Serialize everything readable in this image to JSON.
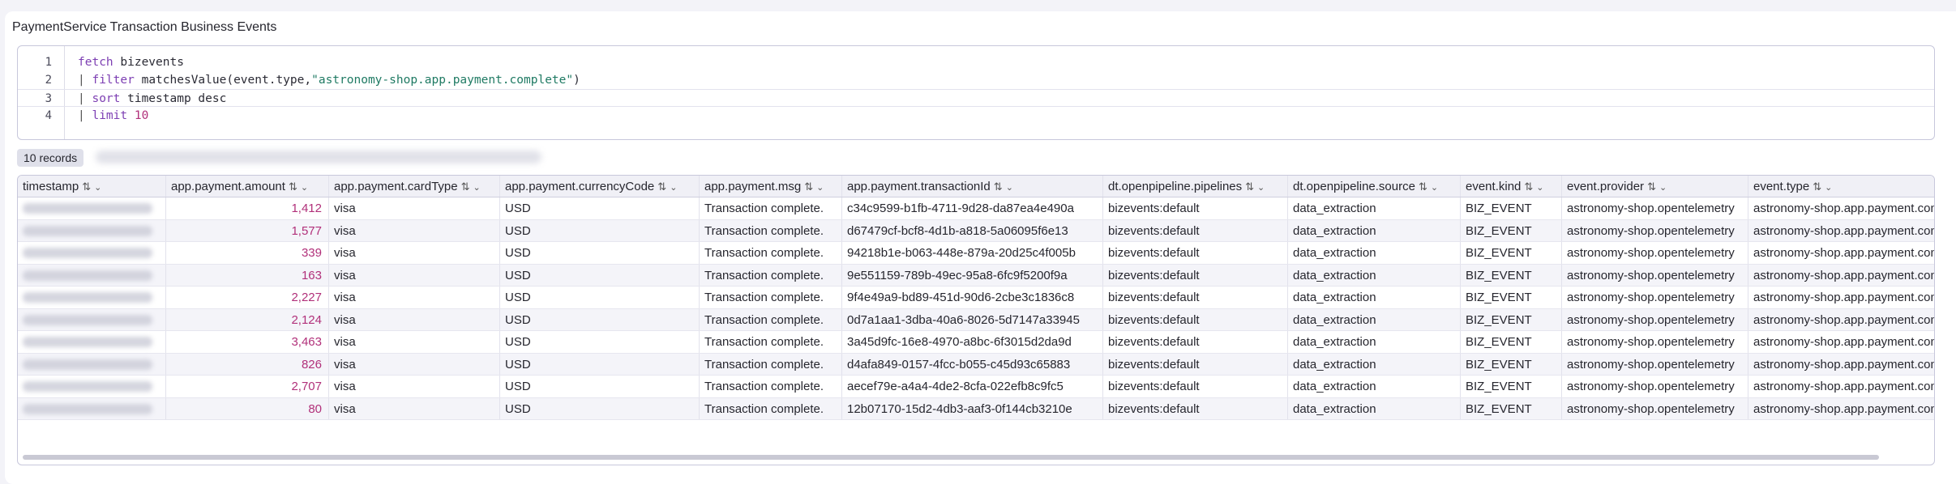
{
  "card": {
    "title": "PaymentService Transaction Business Events"
  },
  "editor": {
    "lines": [
      {
        "num": "1",
        "tokens": [
          {
            "t": "fetch",
            "c": "kw"
          },
          {
            "t": " bizevents",
            "c": ""
          }
        ]
      },
      {
        "num": "2",
        "tokens": [
          {
            "t": "| ",
            "c": "pipe"
          },
          {
            "t": "filter",
            "c": "kw"
          },
          {
            "t": " matchesValue(event.type,",
            "c": ""
          },
          {
            "t": "\"astronomy-shop.app.payment.complete\"",
            "c": "str"
          },
          {
            "t": ")",
            "c": ""
          }
        ]
      },
      {
        "num": "3",
        "tokens": [
          {
            "t": "| ",
            "c": "pipe"
          },
          {
            "t": "sort",
            "c": "kw"
          },
          {
            "t": " timestamp desc",
            "c": ""
          }
        ]
      },
      {
        "num": "4",
        "tokens": [
          {
            "t": "| ",
            "c": "pipe"
          },
          {
            "t": "limit",
            "c": "kw"
          },
          {
            "t": " ",
            "c": ""
          },
          {
            "t": "10",
            "c": "num"
          }
        ]
      }
    ]
  },
  "results": {
    "records_label": "10 records"
  },
  "table": {
    "columns": [
      {
        "key": "timestamp",
        "label": "timestamp"
      },
      {
        "key": "amount",
        "label": "app.payment.amount"
      },
      {
        "key": "cardType",
        "label": "app.payment.cardType"
      },
      {
        "key": "currency",
        "label": "app.payment.currencyCode"
      },
      {
        "key": "msg",
        "label": "app.payment.msg"
      },
      {
        "key": "txid",
        "label": "app.payment.transactionId"
      },
      {
        "key": "pipelines",
        "label": "dt.openpipeline.pipelines"
      },
      {
        "key": "source",
        "label": "dt.openpipeline.source"
      },
      {
        "key": "kind",
        "label": "event.kind"
      },
      {
        "key": "provider",
        "label": "event.provider"
      },
      {
        "key": "type",
        "label": "event.type"
      }
    ],
    "rows": [
      {
        "amount": "1,412",
        "cardType": "visa",
        "currency": "USD",
        "msg": "Transaction complete.",
        "txid": "c34c9599-b1fb-4711-9d28-da87ea4e490a",
        "pipelines": "bizevents:default",
        "source": "data_extraction",
        "kind": "BIZ_EVENT",
        "provider": "astronomy-shop.opentelemetry",
        "type": "astronomy-shop.app.payment.complete"
      },
      {
        "amount": "1,577",
        "cardType": "visa",
        "currency": "USD",
        "msg": "Transaction complete.",
        "txid": "d67479cf-bcf8-4d1b-a818-5a06095f6e13",
        "pipelines": "bizevents:default",
        "source": "data_extraction",
        "kind": "BIZ_EVENT",
        "provider": "astronomy-shop.opentelemetry",
        "type": "astronomy-shop.app.payment.complete"
      },
      {
        "amount": "339",
        "cardType": "visa",
        "currency": "USD",
        "msg": "Transaction complete.",
        "txid": "94218b1e-b063-448e-879a-20d25c4f005b",
        "pipelines": "bizevents:default",
        "source": "data_extraction",
        "kind": "BIZ_EVENT",
        "provider": "astronomy-shop.opentelemetry",
        "type": "astronomy-shop.app.payment.complete"
      },
      {
        "amount": "163",
        "cardType": "visa",
        "currency": "USD",
        "msg": "Transaction complete.",
        "txid": "9e551159-789b-49ec-95a8-6fc9f5200f9a",
        "pipelines": "bizevents:default",
        "source": "data_extraction",
        "kind": "BIZ_EVENT",
        "provider": "astronomy-shop.opentelemetry",
        "type": "astronomy-shop.app.payment.complete"
      },
      {
        "amount": "2,227",
        "cardType": "visa",
        "currency": "USD",
        "msg": "Transaction complete.",
        "txid": "9f4e49a9-bd89-451d-90d6-2cbe3c1836c8",
        "pipelines": "bizevents:default",
        "source": "data_extraction",
        "kind": "BIZ_EVENT",
        "provider": "astronomy-shop.opentelemetry",
        "type": "astronomy-shop.app.payment.complete"
      },
      {
        "amount": "2,124",
        "cardType": "visa",
        "currency": "USD",
        "msg": "Transaction complete.",
        "txid": "0d7a1aa1-3dba-40a6-8026-5d7147a33945",
        "pipelines": "bizevents:default",
        "source": "data_extraction",
        "kind": "BIZ_EVENT",
        "provider": "astronomy-shop.opentelemetry",
        "type": "astronomy-shop.app.payment.complete"
      },
      {
        "amount": "3,463",
        "cardType": "visa",
        "currency": "USD",
        "msg": "Transaction complete.",
        "txid": "3a45d9fc-16e8-4970-a8bc-6f3015d2da9d",
        "pipelines": "bizevents:default",
        "source": "data_extraction",
        "kind": "BIZ_EVENT",
        "provider": "astronomy-shop.opentelemetry",
        "type": "astronomy-shop.app.payment.complete"
      },
      {
        "amount": "826",
        "cardType": "visa",
        "currency": "USD",
        "msg": "Transaction complete.",
        "txid": "d4afa849-0157-4fcc-b055-c45d93c65883",
        "pipelines": "bizevents:default",
        "source": "data_extraction",
        "kind": "BIZ_EVENT",
        "provider": "astronomy-shop.opentelemetry",
        "type": "astronomy-shop.app.payment.complete"
      },
      {
        "amount": "2,707",
        "cardType": "visa",
        "currency": "USD",
        "msg": "Transaction complete.",
        "txid": "aecef79e-a4a4-4de2-8cfa-022efb8c9fc5",
        "pipelines": "bizevents:default",
        "source": "data_extraction",
        "kind": "BIZ_EVENT",
        "provider": "astronomy-shop.opentelemetry",
        "type": "astronomy-shop.app.payment.complete"
      },
      {
        "amount": "80",
        "cardType": "visa",
        "currency": "USD",
        "msg": "Transaction complete.",
        "txid": "12b07170-15d2-4db3-aaf3-0f144cb3210e",
        "pipelines": "bizevents:default",
        "source": "data_extraction",
        "kind": "BIZ_EVENT",
        "provider": "astronomy-shop.opentelemetry",
        "type": "astronomy-shop.app.payment.complete"
      }
    ]
  },
  "icons": {
    "sort": "sort-arrows-icon",
    "menu": "chevron-down-icon"
  }
}
